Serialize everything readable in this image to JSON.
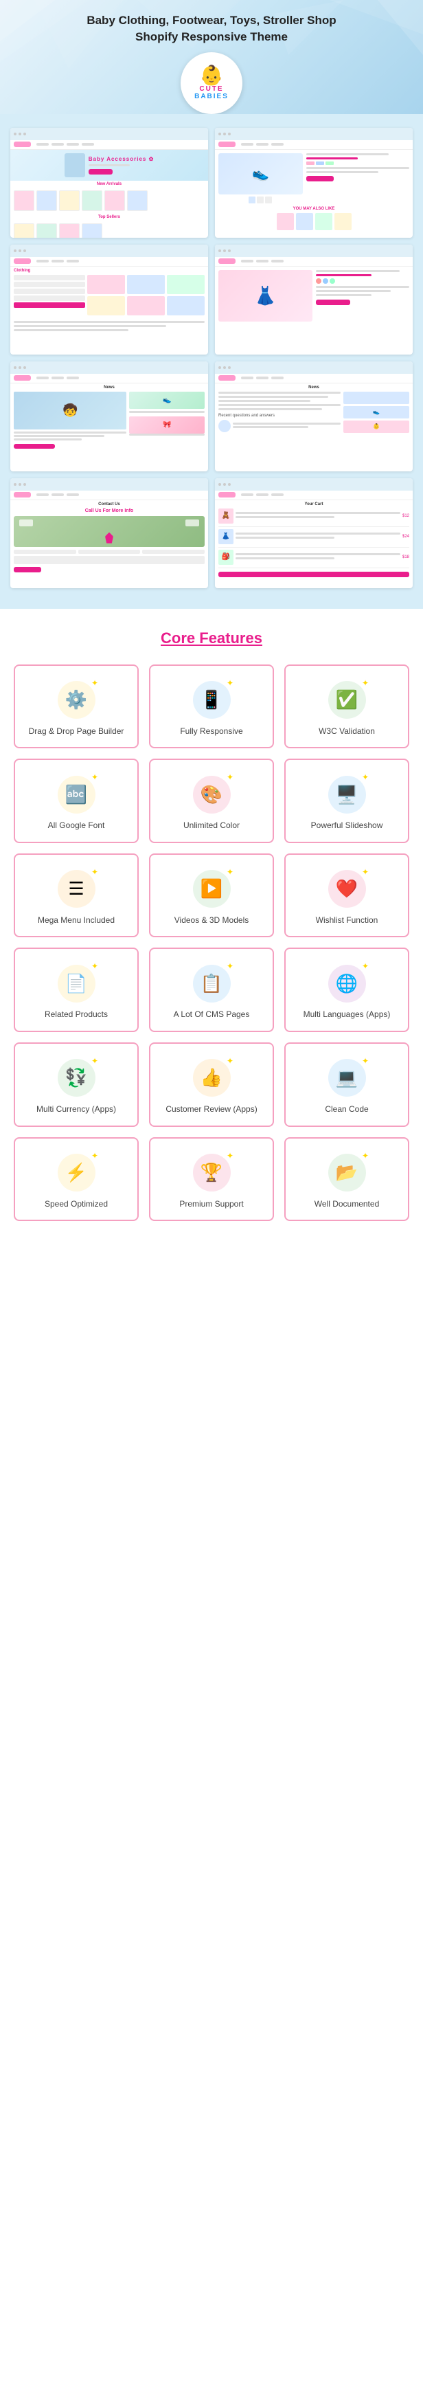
{
  "header": {
    "title_line1": "Baby Clothing, Footwear, Toys, Stroller Shop",
    "title_line2": "Shopify Responsive Theme",
    "logo_icon": "👶",
    "logo_cute": "CUTE",
    "logo_babies": "BABIES"
  },
  "screenshots": [
    {
      "id": "home1",
      "type": "home"
    },
    {
      "id": "home2",
      "type": "product-list"
    },
    {
      "id": "category",
      "type": "category"
    },
    {
      "id": "product",
      "type": "product-detail"
    },
    {
      "id": "blog1",
      "type": "blog"
    },
    {
      "id": "blog2",
      "type": "blog-detail"
    },
    {
      "id": "contact",
      "type": "contact"
    },
    {
      "id": "cart",
      "type": "cart"
    }
  ],
  "features_section": {
    "title": "Core Features",
    "items": [
      {
        "id": "drag-drop",
        "label": "Drag & Drop Page Builder",
        "icon": "⚙️",
        "icon_style": "icon-yellow",
        "star": true
      },
      {
        "id": "responsive",
        "label": "Fully Responsive",
        "icon": "📱",
        "icon_style": "icon-blue",
        "star": true
      },
      {
        "id": "w3c",
        "label": "W3C Validation",
        "icon": "✅",
        "icon_style": "icon-green",
        "star": true
      },
      {
        "id": "google-font",
        "label": "All Google Font",
        "icon": "🔤",
        "icon_style": "icon-yellow",
        "star": true
      },
      {
        "id": "unlimited-color",
        "label": "Unlimited Color",
        "icon": "🎨",
        "icon_style": "icon-pink",
        "star": true
      },
      {
        "id": "slideshow",
        "label": "Powerful Slideshow",
        "icon": "🖥️",
        "icon_style": "icon-blue",
        "star": true
      },
      {
        "id": "mega-menu",
        "label": "Mega Menu Included",
        "icon": "☰",
        "icon_style": "icon-orange",
        "star": true
      },
      {
        "id": "videos",
        "label": "Videos & 3D Models",
        "icon": "▶️",
        "icon_style": "icon-green",
        "star": true
      },
      {
        "id": "wishlist",
        "label": "Wishlist Function",
        "icon": "❤️",
        "icon_style": "icon-pink",
        "star": true
      },
      {
        "id": "related",
        "label": "Related Products",
        "icon": "📄",
        "icon_style": "icon-yellow",
        "star": true
      },
      {
        "id": "cms",
        "label": "A Lot Of CMS Pages",
        "icon": "📋",
        "icon_style": "icon-blue",
        "star": true
      },
      {
        "id": "languages",
        "label": "Multi Languages (Apps)",
        "icon": "🌐",
        "icon_style": "icon-purple",
        "star": true
      },
      {
        "id": "currency",
        "label": "Multi Currency (Apps)",
        "icon": "💱",
        "icon_style": "icon-green",
        "star": true
      },
      {
        "id": "review",
        "label": "Customer Review (Apps)",
        "icon": "👍",
        "icon_style": "icon-orange",
        "star": true
      },
      {
        "id": "clean-code",
        "label": "Clean Code",
        "icon": "💻",
        "icon_style": "icon-blue",
        "star": true
      },
      {
        "id": "speed",
        "label": "Speed Optimized",
        "icon": "⚡",
        "icon_style": "icon-yellow",
        "star": true
      },
      {
        "id": "support",
        "label": "Premium Support",
        "icon": "🏆",
        "icon_style": "icon-pink",
        "star": true
      },
      {
        "id": "documented",
        "label": "Well Documented",
        "icon": "📂",
        "icon_style": "icon-green",
        "star": true
      }
    ]
  }
}
